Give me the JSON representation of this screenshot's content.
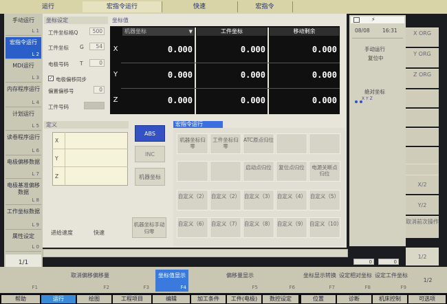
{
  "top_tabs": [
    {
      "label": "运行",
      "active": false
    },
    {
      "label": "宏指令运行",
      "active": true
    },
    {
      "label": "快速",
      "active": false
    },
    {
      "label": "宏指令",
      "active": false
    }
  ],
  "left_nav": [
    {
      "label": "手动运行",
      "key": "L 1",
      "selected": false
    },
    {
      "label": "宏指令运行",
      "key": "L 2",
      "selected": true
    },
    {
      "label": "MDI运行",
      "key": "L 3",
      "selected": false
    },
    {
      "label": "内存程序运行",
      "key": "L 4",
      "selected": false
    },
    {
      "label": "计划运行",
      "key": "L 5",
      "selected": false
    },
    {
      "label": "读卷程序运行",
      "key": "L 6",
      "selected": false
    },
    {
      "label": "电极偏移数据",
      "key": "L 7",
      "selected": false
    },
    {
      "label": "电极基准偏移数据",
      "key": "L 8",
      "selected": false
    },
    {
      "label": "工作坐标数据",
      "key": "L 9",
      "selected": false
    },
    {
      "label": "属性设定",
      "key": "L 0",
      "selected": false
    }
  ],
  "page_indicator": "1/1",
  "settings": {
    "title": "坐标设定",
    "fields": [
      {
        "label": "工件坐标格Q",
        "value": "500"
      },
      {
        "label": "工件坐标",
        "letter": "G",
        "value": "54"
      },
      {
        "label": "电极号码",
        "letter": "T",
        "value": "0"
      }
    ],
    "sync_checkbox": {
      "label": "电极偏移同步",
      "checked": true
    },
    "offset_no": {
      "label": "偏置偏移号",
      "value": "0"
    },
    "work_no": {
      "label": "工件号码",
      "value": ""
    }
  },
  "coord_panel": {
    "title": "坐标值",
    "dropdown": "机器坐标",
    "headers": [
      "工件坐标",
      "移动剩余"
    ],
    "rows": [
      {
        "axis": "X",
        "machine": "0.000",
        "work": "0.000",
        "remaining": "0.000"
      },
      {
        "axis": "Y",
        "machine": "0.000",
        "work": "0.000",
        "remaining": "0.000"
      },
      {
        "axis": "Z",
        "machine": "0.000",
        "work": "0.000",
        "remaining": "0.000"
      }
    ]
  },
  "define_panel": {
    "title": "定义",
    "axes": [
      "X",
      "Y",
      "Z"
    ],
    "feed_label": "进给速度",
    "feed_value": "快速"
  },
  "mode_buttons": {
    "abs": "ABS",
    "inc": "INC",
    "machine_coord": "机器坐标",
    "manual_zero": "机器坐标手动归零"
  },
  "macro_panel": {
    "title": "宏指令运行",
    "rows": [
      [
        "机器坐标归零",
        "工件坐标归零",
        "ATC原点归位",
        "",
        ""
      ],
      [
        "",
        "",
        "启动点归位",
        "复位点归位",
        "电源关断点归位"
      ],
      [
        "自定义（2）",
        "自定义（2）",
        "自定义（3）",
        "自定义（4）",
        "自定义（5）"
      ],
      [
        "自定义（6）",
        "自定义（7）",
        "自定义（8）",
        "自定义（9）",
        "自定义（10）"
      ]
    ]
  },
  "status_panel": {
    "date": "08/08",
    "time": "16:31",
    "mode": "手动运行",
    "state": "复位中",
    "coord_label": "绝对坐标",
    "axes_mini": "X Y Z"
  },
  "right_buttons": [
    "X ORG",
    "Y ORG",
    "Z ORG",
    "",
    "",
    "",
    "",
    "",
    "X/2",
    "Y/2",
    "取消前次操作"
  ],
  "right_page": "1/2",
  "status_readout": [
    "0",
    "0"
  ],
  "function_keys": [
    {
      "label": "",
      "key": "F1",
      "selected": false
    },
    {
      "label": "取消偏移偏移量",
      "key": "F2",
      "selected": false
    },
    {
      "label": "",
      "key": "F3",
      "selected": false
    },
    {
      "label": "坐标值显示",
      "key": "F4",
      "selected": true
    },
    {
      "label": "偏移量显示",
      "key": "F5",
      "selected": false
    },
    {
      "label": "",
      "key": "F6",
      "selected": false
    },
    {
      "label": "坐标显示转换",
      "key": "F7",
      "selected": false
    },
    {
      "label": "设定相对坐标",
      "key": "F8",
      "selected": false
    },
    {
      "label": "设定工件坐标",
      "key": "F9",
      "selected": false
    },
    {
      "label": "1/2",
      "key": "",
      "selected": false
    }
  ],
  "bottom_tabs": [
    {
      "label": "帮助",
      "selected": false
    },
    {
      "label": "运行",
      "selected": true
    },
    {
      "label": "绘图",
      "selected": false
    },
    {
      "label": "工程项目",
      "selected": false
    },
    {
      "label": "编辑",
      "selected": false
    },
    {
      "label": "加工条件",
      "selected": false
    },
    {
      "label": "工件(电极)",
      "selected": false
    },
    {
      "label": "数控设定",
      "selected": false
    },
    {
      "label": "位置",
      "selected": false
    },
    {
      "label": "诊断",
      "selected": false
    },
    {
      "label": "机床控制",
      "selected": false
    },
    {
      "label": "可选项",
      "selected": false
    }
  ]
}
